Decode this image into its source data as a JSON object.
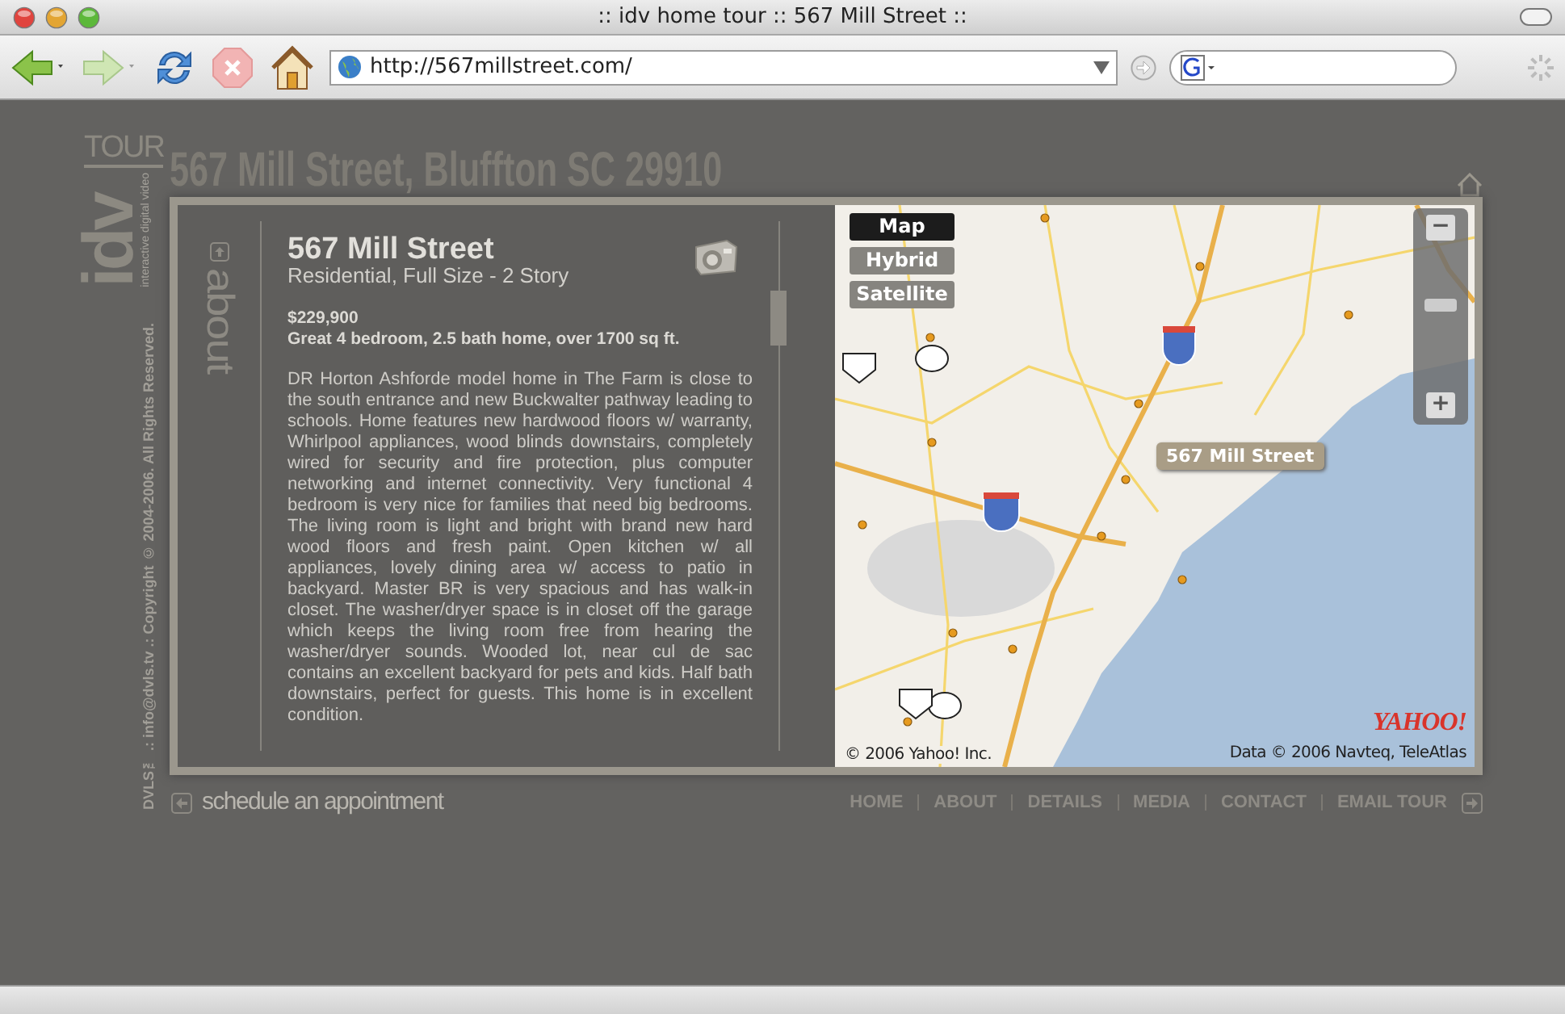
{
  "window": {
    "title": ":: idv home tour :: 567 Mill Street ::",
    "url": "http://567millstreet.com/"
  },
  "logo": {
    "word": "TOUR",
    "mark": "idv",
    "tagline": "interactive digital video"
  },
  "copyright": "DVLS™ .: info@dvls.tv .: Copyright © 2004-2006. All Rights Reserved.",
  "header_title": "567 Mill Street, Bluffton SC 29910",
  "section_label": "about",
  "listing": {
    "title": "567 Mill Street",
    "subtitle": "Residential, Full Size - 2 Story",
    "price": "$229,900",
    "summary": "Great 4 bedroom, 2.5 bath home, over 1700 sq ft.",
    "description": "DR Horton Ashforde model home in The Farm is close to the south entrance and new Buckwalter pathway leading to schools. Home features new hardwood floors w/ warranty, Whirlpool appliances, wood blinds downstairs, completely wired for security and fire protection,  plus computer networking and internet connectivity. Very functional 4 bedroom is very nice for families that need big bedrooms. The living room is light and bright with brand new hard wood floors and fresh paint. Open kitchen w/ all appliances, lovely dining area w/ access to patio in backyard. Master BR is very spacious and has walk-in closet. The washer/dryer space is in closet off the garage which keeps the living room free from hearing the washer/dryer sounds. Wooded lot, near cul de sac contains an excellent backyard for pets and kids. Half bath downstairs, perfect for guests. This home is in excellent condition."
  },
  "map": {
    "modes": [
      {
        "label": "Map",
        "selected": true
      },
      {
        "label": "Hybrid",
        "selected": false
      },
      {
        "label": "Satellite",
        "selected": false
      }
    ],
    "zoom_out": "−",
    "zoom_in": "+",
    "marker_label": "567 Mill Street",
    "logo": "YAHOO!",
    "copyright": "© 2006 Yahoo! Inc.",
    "data_credit": "Data © 2006 Navteq, TeleAtlas"
  },
  "schedule_link": "schedule an appointment",
  "nav": [
    {
      "label": "HOME"
    },
    {
      "label": "ABOUT"
    },
    {
      "label": "DETAILS"
    },
    {
      "label": "MEDIA"
    },
    {
      "label": "CONTACT"
    },
    {
      "label": "EMAIL TOUR"
    }
  ]
}
